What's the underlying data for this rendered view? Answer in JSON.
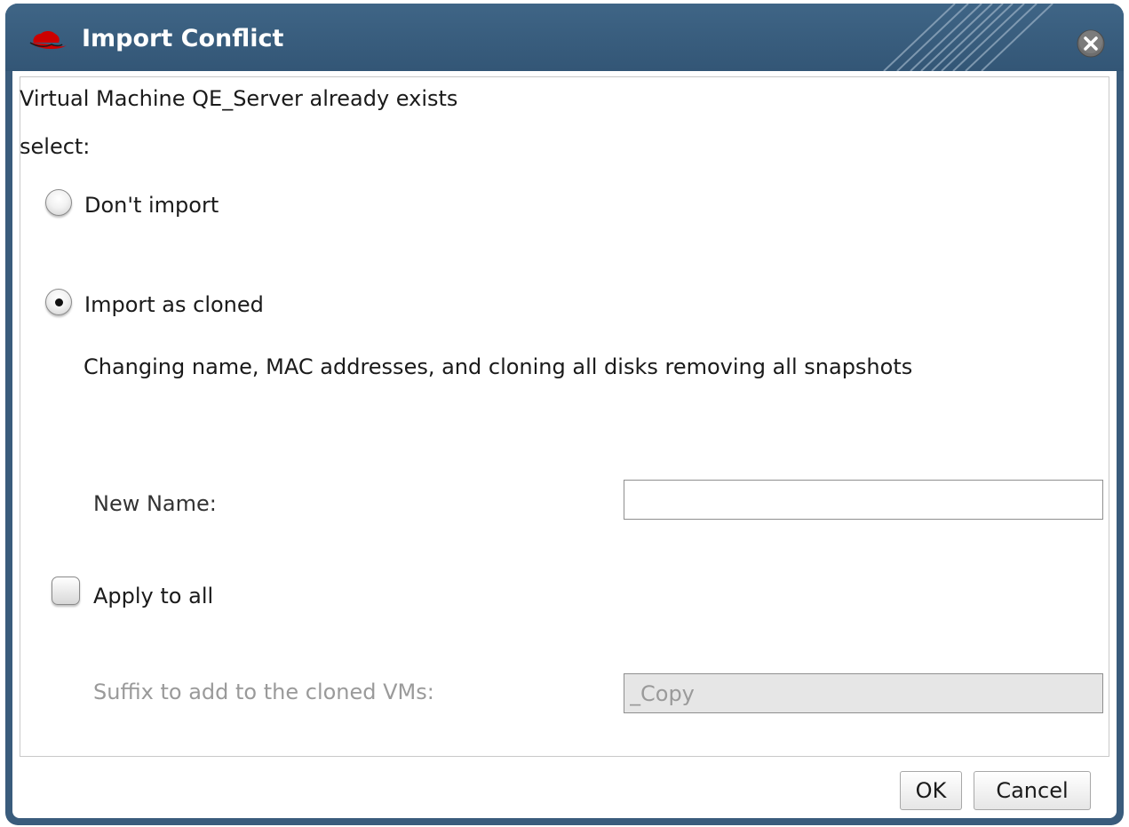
{
  "dialog": {
    "title": "Import Conflict",
    "logo_icon": "redhat-logo-icon",
    "close_icon": "close-icon"
  },
  "content": {
    "message": "Virtual Machine QE_Server already exists",
    "select_label": "select:",
    "options": {
      "dont_import": {
        "label": "Don't import",
        "selected": false
      },
      "import_as_cloned": {
        "label": "Import as cloned",
        "selected": true,
        "description": "Changing name, MAC addresses, and cloning all disks removing all snapshots"
      }
    },
    "new_name": {
      "label": "New Name:",
      "value": ""
    },
    "apply_to_all": {
      "label": "Apply to all",
      "checked": false
    },
    "suffix": {
      "label": "Suffix to add to the cloned VMs:",
      "value": "_Copy",
      "disabled": true
    }
  },
  "buttons": {
    "ok": "OK",
    "cancel": "Cancel"
  },
  "colors": {
    "titlebar": "#3a5c7c",
    "title_text": "#ffffff",
    "logo": "#cc0000"
  }
}
